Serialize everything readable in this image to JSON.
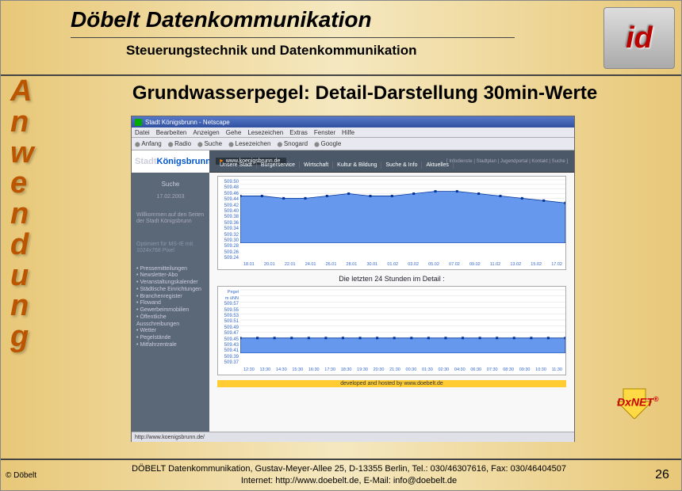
{
  "header": {
    "title": "Döbelt Datenkommunikation",
    "subtitle": "Steuerungstechnik und Datenkommunikation",
    "logo_text": "id"
  },
  "sidebar_word": "Anwendung",
  "content": {
    "title": "Grundwasserpegel: Detail-Darstellung 30min-Werte"
  },
  "browser": {
    "window_title": "Stadt Königsbrunn - Netscape",
    "menu": [
      "Datei",
      "Bearbeiten",
      "Anzeigen",
      "Gehe",
      "Lesezeichen",
      "Extras",
      "Fenster",
      "Hilfe"
    ],
    "toolbar": [
      "Anfang",
      "Radio",
      "Suche",
      "Lesezeichen",
      "Snogard",
      "Google"
    ],
    "url_label": "www.koenigsbrunn.de",
    "top_links": "[ Infodienste | Stadtplan | Jugendportal | Kontakt | Suche ]",
    "nav_menu": [
      "Unsere Stadt",
      "Bürgerservice",
      "Wirtschaft",
      "Kultur & Bildung",
      "Suche & Info",
      "Aktuelles"
    ],
    "site_logo": {
      "pre": "Stadt",
      "main": "Königsbrunn"
    },
    "side": {
      "suche": "Suche",
      "date": "17.02.2003",
      "welcome": "Willkommen auf den Seiten der Stadt Königsbrunn",
      "optimized": "Optimiert für MS-IE mit 1024x768 Pixel",
      "links": [
        "Pressemitteilungen",
        "Newsletter-Abo",
        "Veranstaltungskalender",
        "Städtische Einrichtungen",
        "Branchenregister",
        "Flowand",
        "Gewerbeimmobilien",
        "Öffentliche Ausschreibungen",
        "Wetter",
        "Pegelstände",
        "Mitfahrzentrale"
      ]
    },
    "chart_subtitle": "Die letzten 24 Stunden im Detail :",
    "ylab1": "Pegel",
    "ylab2": "m üNN",
    "dev_by": "developed and hosted by www.doebelt.de",
    "status_url": "http://www.koenigsbrunn.de/"
  },
  "chart_data": [
    {
      "type": "area",
      "title": "",
      "xlabel": "",
      "ylabel": "Pegel m üNN",
      "ylim": [
        509.24,
        509.5
      ],
      "yticks": [
        509.5,
        509.48,
        509.46,
        509.44,
        509.42,
        509.4,
        509.38,
        509.36,
        509.34,
        509.32,
        509.3,
        509.28,
        509.26,
        509.24
      ],
      "categories": [
        "18.01",
        "20.01",
        "22.01",
        "24.01",
        "26.01",
        "28.01",
        "30.01",
        "01.02",
        "03.02",
        "05.02",
        "07.02",
        "09.02",
        "11.02",
        "13.02",
        "15.02",
        "17.02"
      ],
      "series": [
        {
          "name": "Pegel",
          "values": [
            509.43,
            509.43,
            509.42,
            509.42,
            509.43,
            509.44,
            509.43,
            509.43,
            509.44,
            509.45,
            509.45,
            509.44,
            509.43,
            509.42,
            509.41,
            509.4
          ]
        }
      ]
    },
    {
      "type": "area",
      "title": "Die letzten 24 Stunden im Detail :",
      "xlabel": "",
      "ylabel": "Pegel m üNN",
      "ylim": [
        509.37,
        509.57
      ],
      "yticks": [
        509.57,
        509.55,
        509.53,
        509.51,
        509.49,
        509.47,
        509.45,
        509.43,
        509.41,
        509.39,
        509.37
      ],
      "categories": [
        "12:30",
        "13:30",
        "14:30",
        "15:30",
        "16:30",
        "17:30",
        "18:30",
        "19:30",
        "20:30",
        "21:30",
        "00:30",
        "01:30",
        "02:30",
        "04:30",
        "06:30",
        "07:30",
        "08:30",
        "09:30",
        "10:30",
        "11:30"
      ],
      "series": [
        {
          "name": "Pegel",
          "values": [
            509.41,
            509.41,
            509.41,
            509.41,
            509.41,
            509.41,
            509.41,
            509.41,
            509.41,
            509.41,
            509.41,
            509.41,
            509.41,
            509.41,
            509.41,
            509.41,
            509.41,
            509.41,
            509.41,
            509.41
          ]
        }
      ]
    }
  ],
  "product": {
    "name": "DxNET",
    "reg": "®"
  },
  "footer": {
    "copyright": "© Döbelt",
    "line1": "DÖBELT Datenkommunikation, Gustav-Meyer-Allee 25, D-13355 Berlin, Tel.: 030/46307616, Fax: 030/46404507",
    "line2": "Internet: http://www.doebelt.de, E-Mail: info@doebelt.de",
    "page": "26"
  }
}
